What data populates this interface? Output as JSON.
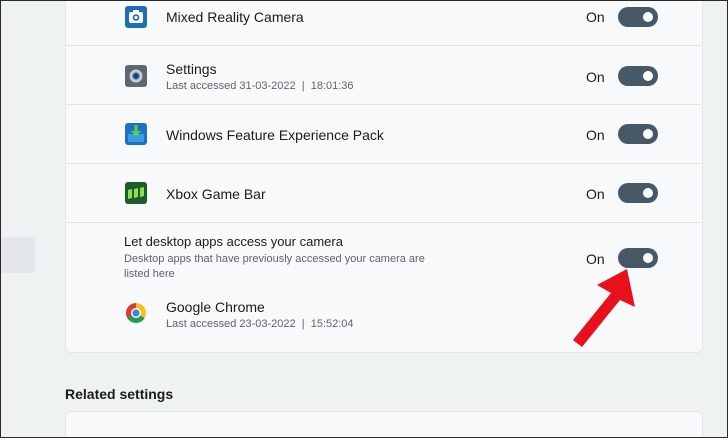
{
  "rows": [
    {
      "title": "Mixed Reality Camera",
      "state": "On",
      "icon": "camera-icon"
    },
    {
      "title": "Settings",
      "subtitle": "Last accessed 31-03-2022  |  18:01:36",
      "state": "On",
      "icon": "settings-gear-icon"
    },
    {
      "title": "Windows Feature Experience Pack",
      "state": "On",
      "icon": "download-package-icon"
    },
    {
      "title": "Xbox Game Bar",
      "state": "On",
      "icon": "xbox-game-bar-icon"
    }
  ],
  "desktop": {
    "title": "Let desktop apps access your camera",
    "description_line1": "Desktop apps that have previously accessed your camera are",
    "description_line2": "listed here",
    "state": "On"
  },
  "chrome": {
    "title": "Google Chrome",
    "subtitle": "Last accessed 23-03-2022  |  15:52:04",
    "icon": "chrome-icon"
  },
  "related": {
    "heading": "Related settings"
  },
  "colors": {
    "toggle_on": "#475866",
    "arrow": "#e8101a",
    "card": "#f8f9fa",
    "background": "#eef2f3"
  }
}
